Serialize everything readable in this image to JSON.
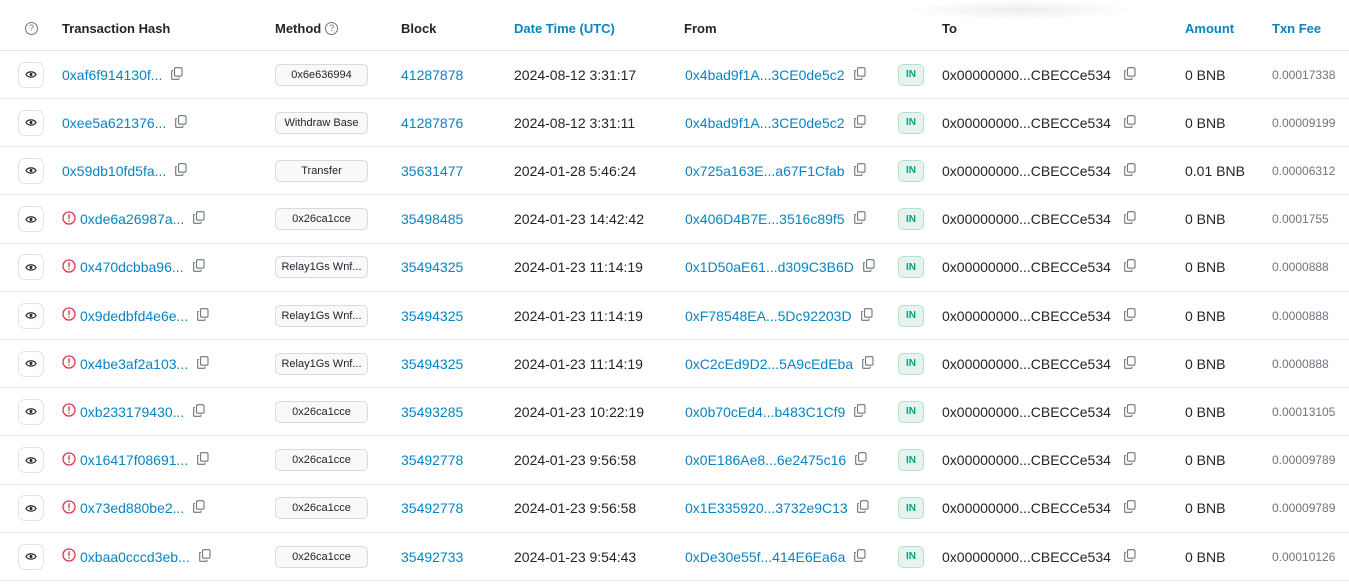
{
  "header": {
    "help_icon_label": "?",
    "tx_hash": "Transaction Hash",
    "method": "Method",
    "block": "Block",
    "datetime": "Date Time (UTC)",
    "from": "From",
    "to": "To",
    "amount": "Amount",
    "fee": "Txn Fee"
  },
  "colors": {
    "link": "#0784c3",
    "in_badge": "#00a186",
    "error": "#dc3545"
  },
  "direction_label": "IN",
  "rows": [
    {
      "hash": "0xaf6f914130f...",
      "error": false,
      "method": "0x6e636994",
      "block": "41287878",
      "date": "2024-08-12 3:31:17",
      "from": "0x4bad9f1A...3CE0de5c2",
      "to": "0x00000000...CBECCe534",
      "amount": "0 BNB",
      "fee": "0.00017338"
    },
    {
      "hash": "0xee5a621376...",
      "error": false,
      "method": "Withdraw Base",
      "block": "41287876",
      "date": "2024-08-12 3:31:11",
      "from": "0x4bad9f1A...3CE0de5c2",
      "to": "0x00000000...CBECCe534",
      "amount": "0 BNB",
      "fee": "0.00009199"
    },
    {
      "hash": "0x59db10fd5fa...",
      "error": false,
      "method": "Transfer",
      "block": "35631477",
      "date": "2024-01-28 5:46:24",
      "from": "0x725a163E...a67F1Cfab",
      "to": "0x00000000...CBECCe534",
      "amount": "0.01 BNB",
      "fee": "0.00006312"
    },
    {
      "hash": "0xde6a26987a...",
      "error": true,
      "method": "0x26ca1cce",
      "block": "35498485",
      "date": "2024-01-23 14:42:42",
      "from": "0x406D4B7E...3516c89f5",
      "to": "0x00000000...CBECCe534",
      "amount": "0 BNB",
      "fee": "0.0001755"
    },
    {
      "hash": "0x470dcbba96...",
      "error": true,
      "method": "Relay1Gs Wnf...",
      "block": "35494325",
      "date": "2024-01-23 11:14:19",
      "from": "0x1D50aE61...d309C3B6D",
      "to": "0x00000000...CBECCe534",
      "amount": "0 BNB",
      "fee": "0.0000888"
    },
    {
      "hash": "0x9dedbfd4e6e...",
      "error": true,
      "method": "Relay1Gs Wnf...",
      "block": "35494325",
      "date": "2024-01-23 11:14:19",
      "from": "0xF78548EA...5Dc92203D",
      "to": "0x00000000...CBECCe534",
      "amount": "0 BNB",
      "fee": "0.0000888"
    },
    {
      "hash": "0x4be3af2a103...",
      "error": true,
      "method": "Relay1Gs Wnf...",
      "block": "35494325",
      "date": "2024-01-23 11:14:19",
      "from": "0xC2cEd9D2...5A9cEdEba",
      "to": "0x00000000...CBECCe534",
      "amount": "0 BNB",
      "fee": "0.0000888"
    },
    {
      "hash": "0xb233179430...",
      "error": true,
      "method": "0x26ca1cce",
      "block": "35493285",
      "date": "2024-01-23 10:22:19",
      "from": "0x0b70cEd4...b483C1Cf9",
      "to": "0x00000000...CBECCe534",
      "amount": "0 BNB",
      "fee": "0.00013105"
    },
    {
      "hash": "0x16417f08691...",
      "error": true,
      "method": "0x26ca1cce",
      "block": "35492778",
      "date": "2024-01-23 9:56:58",
      "from": "0x0E186Ae8...6e2475c16",
      "to": "0x00000000...CBECCe534",
      "amount": "0 BNB",
      "fee": "0.00009789"
    },
    {
      "hash": "0x73ed880be2...",
      "error": true,
      "method": "0x26ca1cce",
      "block": "35492778",
      "date": "2024-01-23 9:56:58",
      "from": "0x1E335920...3732e9C13",
      "to": "0x00000000...CBECCe534",
      "amount": "0 BNB",
      "fee": "0.00009789"
    },
    {
      "hash": "0xbaa0cccd3eb...",
      "error": true,
      "method": "0x26ca1cce",
      "block": "35492733",
      "date": "2024-01-23 9:54:43",
      "from": "0xDe30e55f...414E6Ea6a",
      "to": "0x00000000...CBECCe534",
      "amount": "0 BNB",
      "fee": "0.00010126"
    }
  ]
}
